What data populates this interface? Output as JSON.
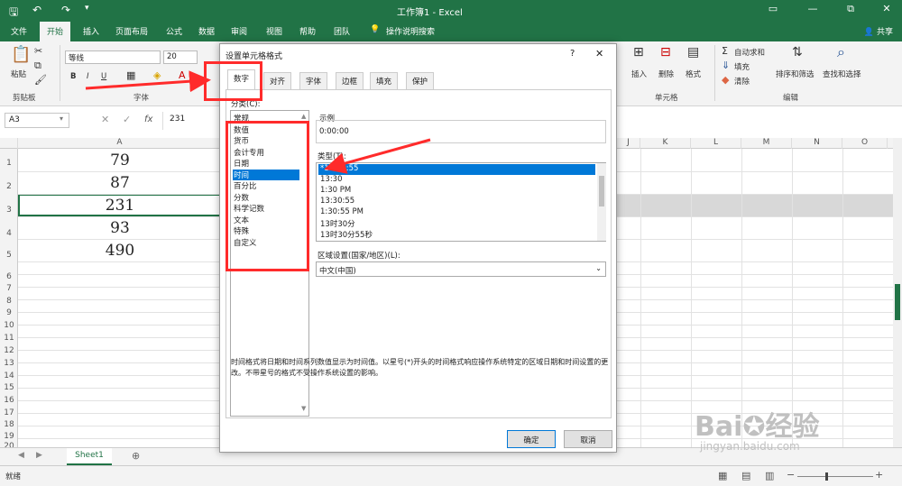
{
  "window": {
    "title": "工作簿1  -  Excel",
    "controls": [
      "▭",
      "—",
      "⧉",
      "✕"
    ]
  },
  "ribbon_tabs": [
    "文件",
    "开始",
    "插入",
    "页面布局",
    "公式",
    "数据",
    "审阅",
    "视图",
    "帮助",
    "团队",
    "操作说明搜索"
  ],
  "share_label": "共享",
  "ribbon": {
    "paste": "粘贴",
    "clipboard_group": "剪贴板",
    "font_name": "等线",
    "font_size": "20",
    "font_group": "字体",
    "bold": "B",
    "italic": "I",
    "underline": "U",
    "insert": "插入",
    "delete": "删除",
    "format": "格式",
    "cells_group": "单元格",
    "autosum": "自动求和",
    "fill": "填充",
    "clear": "清除",
    "sort_filter": "排序和筛选",
    "find_select": "查找和选择",
    "edit_group": "编辑"
  },
  "formula_bar": {
    "name_box": "A3",
    "fx": "fx",
    "value": "231"
  },
  "columns": [
    "A",
    "J",
    "K",
    "L",
    "M",
    "N",
    "O"
  ],
  "rows": [
    "1",
    "2",
    "3",
    "4",
    "5",
    "6",
    "7",
    "8",
    "9",
    "10",
    "11",
    "12",
    "13",
    "14",
    "15",
    "16",
    "17",
    "18",
    "19",
    "20"
  ],
  "cell_values": [
    "79",
    "87",
    "231",
    "93",
    "490"
  ],
  "sheet_tab": "Sheet1",
  "status": "就绪",
  "dialog": {
    "title": "设置单元格格式",
    "help": "?",
    "close": "✕",
    "tabs": [
      "数字",
      "对齐",
      "字体",
      "边框",
      "填充",
      "保护"
    ],
    "category_label": "分类(C):",
    "categories": [
      "常规",
      "数值",
      "货币",
      "会计专用",
      "日期",
      "时间",
      "百分比",
      "分数",
      "科学记数",
      "文本",
      "特殊",
      "自定义"
    ],
    "sample_label": "示例",
    "sample_value": "0:00:00",
    "type_label": "类型(T):",
    "types": [
      "*13:30:55",
      "13:30",
      "1:30 PM",
      "13:30:55",
      "1:30:55 PM",
      "13时30分",
      "13时30分55秒"
    ],
    "locale_label": "区域设置(国家/地区)(L):",
    "locale_value": "中文(中国)",
    "description": "时间格式将日期和时间系列数值显示为时间值。以星号(*)开头的时间格式响应操作系统特定的区域日期和时间设置的更改。不带星号的格式不受操作系统设置的影响。",
    "ok": "确定",
    "cancel": "取消"
  },
  "watermark": {
    "brand": "Bai",
    "brand2": "经验",
    "url": "jingyan.baidu.com"
  },
  "colors": {
    "excel_green": "#217346",
    "selection_blue": "#0078d7",
    "annotation_red": "#ff2b2b"
  }
}
